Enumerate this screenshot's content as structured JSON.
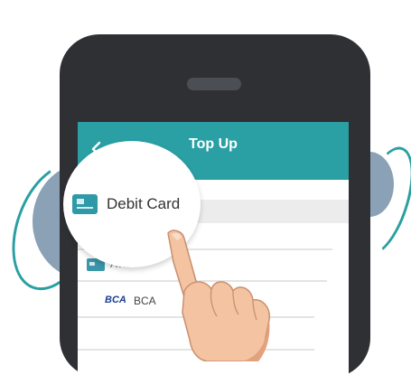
{
  "appbar": {
    "title": "Top Up"
  },
  "magnifier": {
    "label": "Debit Card"
  },
  "list": {
    "items": [
      {
        "label": "ATM",
        "icon": "card-icon"
      },
      {
        "label": "BCA",
        "logo": "BCA"
      }
    ]
  },
  "colors": {
    "accent": "#2aa0a4",
    "phone_body": "#2e3034",
    "decor_circle": "#8aa1b6",
    "bca_blue": "#1c3e8f"
  }
}
